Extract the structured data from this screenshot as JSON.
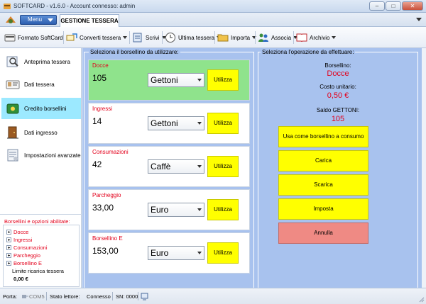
{
  "window": {
    "title": "SOFTCARD - v1.6.0 - Account connesso: admin",
    "min": "–",
    "max": "□",
    "close": "✕"
  },
  "menu": {
    "button_label": "Menu",
    "tab_label": "GESTIONE TESSERA"
  },
  "toolbar": {
    "formato": "Formato SoftCard",
    "converti": "Converti tessera",
    "scrivi": "Scrivi",
    "ultima": "Ultima tessera",
    "importa": "Importa",
    "associa": "Associa",
    "archivio": "Archivio"
  },
  "nav": [
    {
      "label": "Anteprima tessera"
    },
    {
      "label": "Dati tessera"
    },
    {
      "label": "Credito borsellini"
    },
    {
      "label": "Dati ingresso"
    },
    {
      "label": "Impostazioni avanzate"
    }
  ],
  "tree": {
    "heading": "Borsellini e opzioni abilitate:",
    "items": [
      "Docce",
      "Ingressi",
      "Consumazioni",
      "Parcheggio",
      "Borsellino E"
    ],
    "limit_label": "Limite ricarica tessera",
    "limit_value": "0,00 €"
  },
  "left_group": {
    "title": "Seleziona il borsellino da utilizzare:",
    "use_label": "Utilizza",
    "wallets": [
      {
        "name": "Docce",
        "value": "105",
        "unit": "Gettoni"
      },
      {
        "name": "Ingressi",
        "value": "14",
        "unit": "Gettoni"
      },
      {
        "name": "Consumazioni",
        "value": "42",
        "unit": "Caffè"
      },
      {
        "name": "Parcheggio",
        "value": "33,00",
        "unit": "Euro"
      },
      {
        "name": "Borsellino E",
        "value": "153,00",
        "unit": "Euro"
      }
    ]
  },
  "right_group": {
    "title": "Seleziona l'operazione da effettuare:",
    "wallet_label": "Borsellino:",
    "wallet_value": "Docce",
    "cost_label": "Costo unitario:",
    "cost_value": "0,50 €",
    "balance_label": "Saldo GETTONI:",
    "balance_value": "105",
    "buttons": {
      "use_as_consumption": "Usa come borsellino a consumo",
      "load": "Carica",
      "unload": "Scarica",
      "set": "Imposta",
      "cancel": "Annulla"
    }
  },
  "status": {
    "port_label": "Porta:",
    "port_value": "COM5",
    "reader_label": "Stato lettore:",
    "reader_value": "Connesso",
    "sn": "SN: 0000"
  },
  "colors": {
    "accent_green": "#8fe38c",
    "button_yellow": "#ffff00",
    "cancel_red": "#ef8a84",
    "label_red": "#e3001b",
    "panel_blue": "#a8c2ee"
  }
}
